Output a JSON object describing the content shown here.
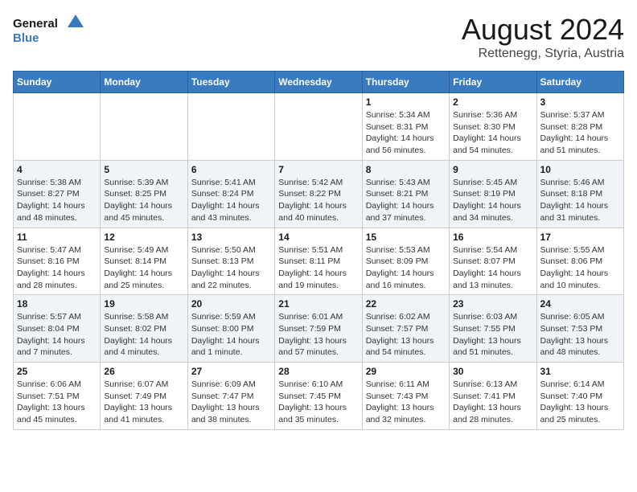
{
  "header": {
    "logo_line1": "General",
    "logo_line2": "Blue",
    "month_year": "August 2024",
    "location": "Rettenegg, Styria, Austria"
  },
  "weekdays": [
    "Sunday",
    "Monday",
    "Tuesday",
    "Wednesday",
    "Thursday",
    "Friday",
    "Saturday"
  ],
  "weeks": [
    [
      {
        "day": "",
        "info": ""
      },
      {
        "day": "",
        "info": ""
      },
      {
        "day": "",
        "info": ""
      },
      {
        "day": "",
        "info": ""
      },
      {
        "day": "1",
        "info": "Sunrise: 5:34 AM\nSunset: 8:31 PM\nDaylight: 14 hours\nand 56 minutes."
      },
      {
        "day": "2",
        "info": "Sunrise: 5:36 AM\nSunset: 8:30 PM\nDaylight: 14 hours\nand 54 minutes."
      },
      {
        "day": "3",
        "info": "Sunrise: 5:37 AM\nSunset: 8:28 PM\nDaylight: 14 hours\nand 51 minutes."
      }
    ],
    [
      {
        "day": "4",
        "info": "Sunrise: 5:38 AM\nSunset: 8:27 PM\nDaylight: 14 hours\nand 48 minutes."
      },
      {
        "day": "5",
        "info": "Sunrise: 5:39 AM\nSunset: 8:25 PM\nDaylight: 14 hours\nand 45 minutes."
      },
      {
        "day": "6",
        "info": "Sunrise: 5:41 AM\nSunset: 8:24 PM\nDaylight: 14 hours\nand 43 minutes."
      },
      {
        "day": "7",
        "info": "Sunrise: 5:42 AM\nSunset: 8:22 PM\nDaylight: 14 hours\nand 40 minutes."
      },
      {
        "day": "8",
        "info": "Sunrise: 5:43 AM\nSunset: 8:21 PM\nDaylight: 14 hours\nand 37 minutes."
      },
      {
        "day": "9",
        "info": "Sunrise: 5:45 AM\nSunset: 8:19 PM\nDaylight: 14 hours\nand 34 minutes."
      },
      {
        "day": "10",
        "info": "Sunrise: 5:46 AM\nSunset: 8:18 PM\nDaylight: 14 hours\nand 31 minutes."
      }
    ],
    [
      {
        "day": "11",
        "info": "Sunrise: 5:47 AM\nSunset: 8:16 PM\nDaylight: 14 hours\nand 28 minutes."
      },
      {
        "day": "12",
        "info": "Sunrise: 5:49 AM\nSunset: 8:14 PM\nDaylight: 14 hours\nand 25 minutes."
      },
      {
        "day": "13",
        "info": "Sunrise: 5:50 AM\nSunset: 8:13 PM\nDaylight: 14 hours\nand 22 minutes."
      },
      {
        "day": "14",
        "info": "Sunrise: 5:51 AM\nSunset: 8:11 PM\nDaylight: 14 hours\nand 19 minutes."
      },
      {
        "day": "15",
        "info": "Sunrise: 5:53 AM\nSunset: 8:09 PM\nDaylight: 14 hours\nand 16 minutes."
      },
      {
        "day": "16",
        "info": "Sunrise: 5:54 AM\nSunset: 8:07 PM\nDaylight: 14 hours\nand 13 minutes."
      },
      {
        "day": "17",
        "info": "Sunrise: 5:55 AM\nSunset: 8:06 PM\nDaylight: 14 hours\nand 10 minutes."
      }
    ],
    [
      {
        "day": "18",
        "info": "Sunrise: 5:57 AM\nSunset: 8:04 PM\nDaylight: 14 hours\nand 7 minutes."
      },
      {
        "day": "19",
        "info": "Sunrise: 5:58 AM\nSunset: 8:02 PM\nDaylight: 14 hours\nand 4 minutes."
      },
      {
        "day": "20",
        "info": "Sunrise: 5:59 AM\nSunset: 8:00 PM\nDaylight: 14 hours\nand 1 minute."
      },
      {
        "day": "21",
        "info": "Sunrise: 6:01 AM\nSunset: 7:59 PM\nDaylight: 13 hours\nand 57 minutes."
      },
      {
        "day": "22",
        "info": "Sunrise: 6:02 AM\nSunset: 7:57 PM\nDaylight: 13 hours\nand 54 minutes."
      },
      {
        "day": "23",
        "info": "Sunrise: 6:03 AM\nSunset: 7:55 PM\nDaylight: 13 hours\nand 51 minutes."
      },
      {
        "day": "24",
        "info": "Sunrise: 6:05 AM\nSunset: 7:53 PM\nDaylight: 13 hours\nand 48 minutes."
      }
    ],
    [
      {
        "day": "25",
        "info": "Sunrise: 6:06 AM\nSunset: 7:51 PM\nDaylight: 13 hours\nand 45 minutes."
      },
      {
        "day": "26",
        "info": "Sunrise: 6:07 AM\nSunset: 7:49 PM\nDaylight: 13 hours\nand 41 minutes."
      },
      {
        "day": "27",
        "info": "Sunrise: 6:09 AM\nSunset: 7:47 PM\nDaylight: 13 hours\nand 38 minutes."
      },
      {
        "day": "28",
        "info": "Sunrise: 6:10 AM\nSunset: 7:45 PM\nDaylight: 13 hours\nand 35 minutes."
      },
      {
        "day": "29",
        "info": "Sunrise: 6:11 AM\nSunset: 7:43 PM\nDaylight: 13 hours\nand 32 minutes."
      },
      {
        "day": "30",
        "info": "Sunrise: 6:13 AM\nSunset: 7:41 PM\nDaylight: 13 hours\nand 28 minutes."
      },
      {
        "day": "31",
        "info": "Sunrise: 6:14 AM\nSunset: 7:40 PM\nDaylight: 13 hours\nand 25 minutes."
      }
    ]
  ]
}
